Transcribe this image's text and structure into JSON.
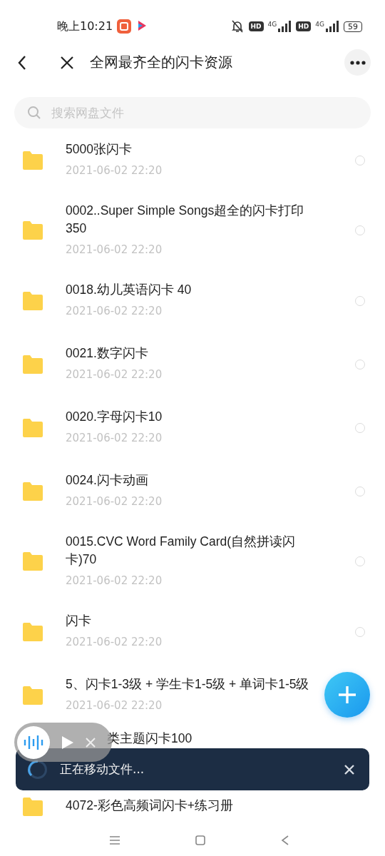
{
  "status_bar": {
    "time": "晚上10:21",
    "sim_1": {
      "hd": "HD",
      "network": "4G"
    },
    "sim_2": {
      "hd": "HD",
      "network": "4G"
    },
    "battery": "59"
  },
  "header": {
    "title": "全网最齐全的闪卡资源"
  },
  "search": {
    "placeholder": "搜索网盘文件"
  },
  "files": [
    {
      "kind": "folder",
      "name": "5000张闪卡",
      "date": "2021-06-02  22:20",
      "selected": false
    },
    {
      "kind": "folder",
      "name": "0002..Super Simple Songs超全的闪卡打印350",
      "date": "2021-06-02  22:20",
      "selected": false
    },
    {
      "kind": "folder",
      "name": "0018.幼儿英语闪卡 40",
      "date": "2021-06-02  22:20",
      "selected": false
    },
    {
      "kind": "folder",
      "name": "0021.数字闪卡",
      "date": "2021-06-02  22:20",
      "selected": false
    },
    {
      "kind": "folder",
      "name": "0020.字母闪卡10",
      "date": "2021-06-02  22:20",
      "selected": false
    },
    {
      "kind": "folder",
      "name": "0024.闪卡动画",
      "date": "2021-06-02  22:20",
      "selected": false
    },
    {
      "kind": "folder",
      "name": "0015.CVC Word Family Card(自然拼读闪卡)70",
      "date": "2021-06-02  22:20",
      "selected": false
    },
    {
      "kind": "folder",
      "name": "闪卡",
      "date": "2021-06-02  22:20",
      "selected": false
    },
    {
      "kind": "folder",
      "name": "5、闪卡1-3级 + 学生卡1-5级 + 单词卡1-5级",
      "date": "2021-06-02  22:20"
    },
    {
      "kind": "covered",
      "name": "类主题闪卡100"
    },
    {
      "kind": "cut",
      "name": "4072-彩色高频词闪卡+练习册"
    }
  ],
  "toast": {
    "text": "正在移动文件..."
  }
}
